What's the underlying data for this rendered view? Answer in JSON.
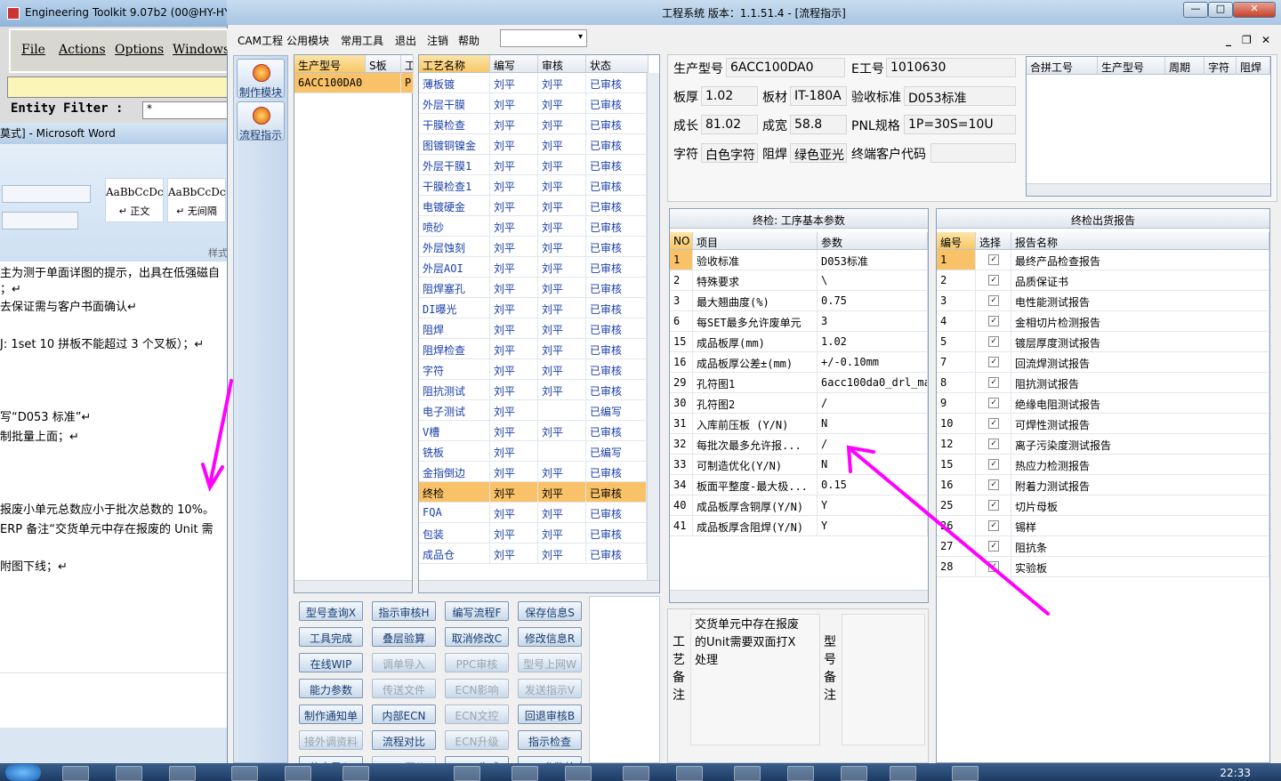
{
  "toolkit": {
    "title": "Engineering Toolkit 9.07b2 (00@HY-HY",
    "menu": [
      "File",
      "Actions",
      "Options",
      "Windows"
    ],
    "filter_label": "Entity Filter :",
    "filter_value": "*"
  },
  "word": {
    "title": "莫式] - Microsoft Word",
    "styles": [
      {
        "sample": "AaBbCcDc",
        "name": "↵ 正文"
      },
      {
        "sample": "AaBbCcDc",
        "name": "↵ 无间隔"
      }
    ],
    "ribbon_group": "样式",
    "lines": [
      "主为测于单面详图的提示，出具在低强磁自",
      "；↵",
      "去保证需与客户书面确认↵",
      "J: 1set 10 拼板不能超过 3 个叉板）；↵",
      "写“D053 标准”↵",
      "制批量上面；↵",
      "报废小单元总数应小于批次总数的 10%。",
      " ERP 备注“交货单元中存在报废的 Unit 需",
      "附图下线；↵"
    ]
  },
  "taskbar": {
    "clock": "22:33"
  },
  "window": {
    "title": "工程系统    版本：1.1.51.4 - [流程指示]",
    "menu": [
      "CAM工程",
      "公用模块",
      "常用工具",
      "退出",
      "注销",
      "帮助"
    ],
    "mdi_buttons": [
      "_",
      "❐",
      "✕"
    ],
    "title_buttons": [
      "—",
      "□",
      "✕"
    ]
  },
  "nav": [
    {
      "label": "制作模块"
    },
    {
      "label": "流程指示"
    }
  ],
  "model_grid": {
    "headers": [
      "生产型号",
      "S板",
      "工"
    ],
    "rows": [
      [
        "6ACC100DA0",
        "P"
      ]
    ]
  },
  "process_grid": {
    "headers": [
      "工艺名称",
      "编写",
      "审核",
      "状态"
    ],
    "rows": [
      [
        "薄板镀",
        "刘平",
        "刘平",
        "已审核"
      ],
      [
        "外层干膜",
        "刘平",
        "刘平",
        "已审核"
      ],
      [
        "干膜检查",
        "刘平",
        "刘平",
        "已审核"
      ],
      [
        "图镀铜镍金",
        "刘平",
        "刘平",
        "已审核"
      ],
      [
        "外层干膜1",
        "刘平",
        "刘平",
        "已审核"
      ],
      [
        "干膜检查1",
        "刘平",
        "刘平",
        "已审核"
      ],
      [
        "电镀硬金",
        "刘平",
        "刘平",
        "已审核"
      ],
      [
        "喷砂",
        "刘平",
        "刘平",
        "已审核"
      ],
      [
        "外层蚀刻",
        "刘平",
        "刘平",
        "已审核"
      ],
      [
        "外层AOI",
        "刘平",
        "刘平",
        "已审核"
      ],
      [
        "阻焊塞孔",
        "刘平",
        "刘平",
        "已审核"
      ],
      [
        "DI曝光",
        "刘平",
        "刘平",
        "已审核"
      ],
      [
        "阻焊",
        "刘平",
        "刘平",
        "已审核"
      ],
      [
        "阻焊检查",
        "刘平",
        "刘平",
        "已审核"
      ],
      [
        "字符",
        "刘平",
        "刘平",
        "已审核"
      ],
      [
        "阻抗测试",
        "刘平",
        "刘平",
        "已审核"
      ],
      [
        "电子测试",
        "刘平",
        "",
        "已编写"
      ],
      [
        "V槽",
        "刘平",
        "刘平",
        "已审核"
      ],
      [
        "铣板",
        "刘平",
        "",
        "已编写"
      ],
      [
        "金指倒边",
        "刘平",
        "刘平",
        "已审核"
      ],
      [
        "终检",
        "刘平",
        "刘平",
        "已审核"
      ],
      [
        "FQA",
        "刘平",
        "刘平",
        "已审核"
      ],
      [
        "包装",
        "刘平",
        "刘平",
        "已审核"
      ],
      [
        "成品仓",
        "刘平",
        "刘平",
        "已审核"
      ]
    ],
    "selected_index": 20
  },
  "info": {
    "fields": [
      {
        "label": "生产型号",
        "value": "6ACC100DA0"
      },
      {
        "label": "E工号",
        "value": "1010630"
      },
      {
        "label": "板厚",
        "value": "1.02"
      },
      {
        "label": "板材",
        "value": "IT-180A"
      },
      {
        "label": "验收标准",
        "value": "D053标准"
      },
      {
        "label": "成长",
        "value": "81.02"
      },
      {
        "label": "成宽",
        "value": "58.8"
      },
      {
        "label": "PNL规格",
        "value": "1P=30S=10U"
      },
      {
        "label": "字符",
        "value": "白色字符"
      },
      {
        "label": "阻焊",
        "value": "绿色亚光"
      },
      {
        "label": "终端客户代码",
        "value": ""
      }
    ],
    "merge_headers": [
      "合拼工号",
      "生产型号",
      "周期",
      "字符",
      "阻焊"
    ]
  },
  "params": {
    "title": "终检: 工序基本参数",
    "headers": [
      "NO",
      "项目",
      "参数"
    ],
    "rows": [
      [
        "1",
        "验收标准",
        "D053标准"
      ],
      [
        "2",
        "特殊要求",
        "\\"
      ],
      [
        "3",
        "最大翘曲度(%)",
        "0.75"
      ],
      [
        "6",
        "每SET最多允许废单元",
        "3"
      ],
      [
        "15",
        "成品板厚(mm)",
        "1.02"
      ],
      [
        "16",
        "成品板厚公差±(mm)",
        "+/-0.10mm"
      ],
      [
        "29",
        "孔符图1",
        "6acc100da0_drl_ma"
      ],
      [
        "30",
        "孔符图2",
        "/"
      ],
      [
        "31",
        "入库前压板 (Y/N)",
        "N"
      ],
      [
        "32",
        "每批次最多允许报...",
        "/"
      ],
      [
        "33",
        "可制造优化(Y/N)",
        "N"
      ],
      [
        "34",
        "板面平整度-最大极...",
        "0.15"
      ],
      [
        "40",
        "成品板厚含铜厚(Y/N)",
        "Y"
      ],
      [
        "41",
        "成品板厚含阻焊(Y/N)",
        "Y"
      ]
    ]
  },
  "reports": {
    "title": "终检出货报告",
    "headers": [
      "编号",
      "选择",
      "报告名称"
    ],
    "rows": [
      [
        "1",
        "最终产品检查报告"
      ],
      [
        "2",
        "品质保证书"
      ],
      [
        "3",
        "电性能测试报告"
      ],
      [
        "4",
        "金相切片检测报告"
      ],
      [
        "5",
        "镀层厚度测试报告"
      ],
      [
        "7",
        "回流焊测试报告"
      ],
      [
        "8",
        "阻抗测试报告"
      ],
      [
        "9",
        "绝缘电阻测试报告"
      ],
      [
        "10",
        "可焊性测试报告"
      ],
      [
        "12",
        "离子污染度测试报告"
      ],
      [
        "15",
        "热应力检测报告"
      ],
      [
        "16",
        "附着力测试报告"
      ],
      [
        "25",
        "切片母板"
      ],
      [
        "26",
        "锡样"
      ],
      [
        "27",
        "阻抗条"
      ],
      [
        "28",
        "实验板"
      ]
    ]
  },
  "remarks": {
    "process_label": "工艺备注",
    "process_text": "交货单元中存在报废的Unit需要双面打X处理",
    "model_label": "型号备注",
    "model_text": ""
  },
  "buttons": [
    [
      {
        "label": "型号查询X",
        "enabled": true
      },
      {
        "label": "指示审核H",
        "enabled": true
      },
      {
        "label": "编写流程F",
        "enabled": true
      },
      {
        "label": "保存信息S",
        "enabled": true
      }
    ],
    [
      {
        "label": "工具完成",
        "enabled": true
      },
      {
        "label": "叠层验算",
        "enabled": true
      },
      {
        "label": "取消修改C",
        "enabled": true
      },
      {
        "label": "修改信息R",
        "enabled": true
      }
    ],
    [
      {
        "label": "在线WIP",
        "enabled": true
      },
      {
        "label": "调单导入",
        "enabled": false
      },
      {
        "label": "PPC审核",
        "enabled": false
      },
      {
        "label": "型号上网W",
        "enabled": false
      }
    ],
    [
      {
        "label": "能力参数",
        "enabled": true
      },
      {
        "label": "传送文件",
        "enabled": false
      },
      {
        "label": "ECN影响",
        "enabled": false
      },
      {
        "label": "发送指示V",
        "enabled": false
      }
    ],
    [
      {
        "label": "制作通知单",
        "enabled": true
      },
      {
        "label": "内部ECN",
        "enabled": true
      },
      {
        "label": "ECN文控",
        "enabled": false
      },
      {
        "label": "回退审核B",
        "enabled": true
      }
    ],
    [
      {
        "label": "接外调资料",
        "enabled": false
      },
      {
        "label": "流程对比",
        "enabled": true
      },
      {
        "label": "ECN升级",
        "enabled": false
      },
      {
        "label": "指示检查",
        "enabled": true
      }
    ],
    [
      {
        "label": "信息导入",
        "enabled": true
      },
      {
        "label": "MRS回传",
        "enabled": false
      },
      {
        "label": "BOM生成",
        "enabled": true
      },
      {
        "label": "BOM参数检查",
        "enabled": true
      }
    ]
  ],
  "colors": {
    "annotation_arrow": "#ff00ff",
    "selected_row": "#f9c268",
    "link_text": "#1a3fa8"
  }
}
